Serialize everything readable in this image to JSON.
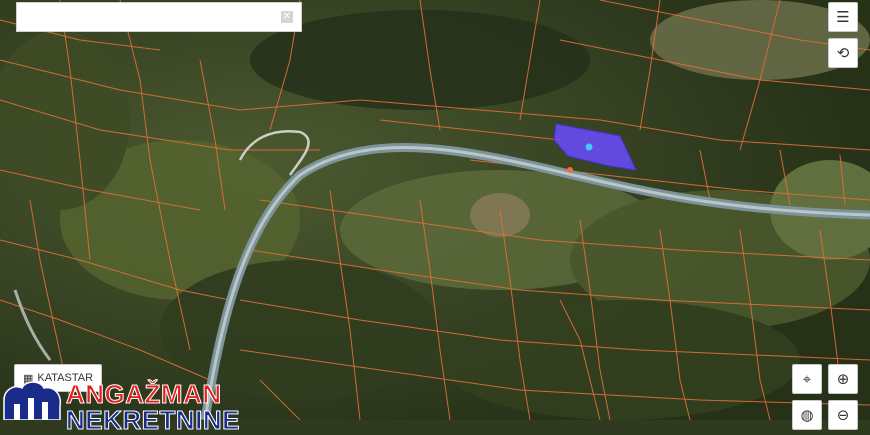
{
  "search": {
    "value": "",
    "placeholder": "",
    "clear_icon": "x-icon"
  },
  "controls": {
    "menu_icon": "hamburger-icon",
    "refresh_icon": "refresh-icon",
    "locate_icon": "crosshair-icon",
    "zoom_in_icon": "plus-icon",
    "zoom_out_icon": "minus-icon",
    "globe_icon": "globe-icon"
  },
  "layer_button": {
    "icon": "map-icon",
    "label": "KATASTAR"
  },
  "logo": {
    "line1": "ANGAŽMAN",
    "line2": "NEKRETNINE",
    "colors": {
      "line1": "#e0211d",
      "line2": "#1a2c8a"
    }
  },
  "map": {
    "parcel_border_color": "#e0703a",
    "highlight_color": "#6a4bff"
  }
}
